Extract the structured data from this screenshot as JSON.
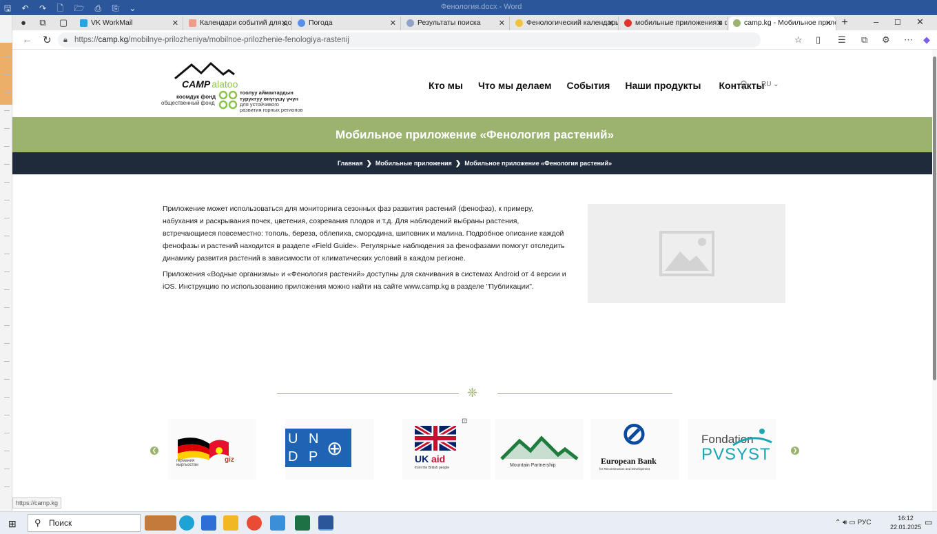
{
  "word": {
    "title": "Фенология.docx - Word",
    "quick_access": "🖫 ↶ ↷ 🗋 🗁 ⎙ ⎘ ⌄"
  },
  "browser": {
    "tabs": [
      {
        "label": "VK WorkMail",
        "color": "#2aa2e0"
      },
      {
        "label": "Календари событий для дош",
        "color": "#f19b8a"
      },
      {
        "label": "Погода",
        "color": "#5a8fe8"
      },
      {
        "label": "Результаты поиска",
        "color": "#8fa3c8"
      },
      {
        "label": "Фенологический календарь",
        "color": "#f2c23a"
      },
      {
        "label": "мобильные приложения в ф",
        "color": "#e2322c"
      },
      {
        "label": "camp.kg - Мобильное прило",
        "color": "#9bb36f"
      }
    ],
    "close_glyph": "✕",
    "new_tab_glyph": "+",
    "url_prefix": "https://",
    "url_domain": "camp.kg",
    "url_path": "/mobilnye-prilozheniya/mobilnoe-prilozhenie-fenologiya-rastenij",
    "status_url": "https://camp.kg"
  },
  "site": {
    "logo": {
      "brand": "CAMP",
      "brand_tail": "alatoo",
      "left_line1": "коомдук фонд",
      "left_line2": "общественный фонд",
      "right_line1": "тоолуу аймактардын",
      "right_line2": "туруктуу өнүгүшү үчүн",
      "right_line3": "для устойчивого",
      "right_line4": "развития горных регионов"
    },
    "nav": [
      "Кто мы",
      "Что мы делаем",
      "События",
      "Наши продукты",
      "Контакты"
    ],
    "lang": "RU",
    "page_title": "Мобильное приложение «Фенология растений»",
    "breadcrumbs": [
      "Главная",
      "Мобильные приложения",
      "Мобильное приложение «Фенология растений»"
    ],
    "paragraph1": "Приложение может использоваться для мониторинга сезонных фаз развития растений (фенофаз), к примеру, набухания и раскрывания почек, цветения, созревания плодов и т.д. Для наблюдений выбраны растения, встречающиеся повсеместно: тополь, береза, облепиха, смородина, шиповник и малина. Подробное описание каждой фенофазы и растений находится в разделе «Field Guide». Регулярные наблюдения за фенофазами помогут отследить динамику развития растений в зависимости от климатических условий в каждом регионе.",
    "paragraph2": "Приложения «Водные организмы» и «Фенология растений» доступны для скачивания в системах Android от 4 версии и iOS. Инструкцию по использованию приложения можно найти на сайте www.camp.kg в разделе \"Публикации\".",
    "partners": [
      {
        "line1": "германия",
        "line2": "кыргызстан",
        "mark": "giz"
      },
      {
        "line1": "U N",
        "line2": "D P"
      },
      {
        "line1": "UK",
        "line2": "aid",
        "line3": "from the British people"
      },
      {
        "line1": "Mountain Partnership"
      },
      {
        "line1": "European Bank",
        "line2": "for Reconstruction and Development"
      },
      {
        "line1": "Fondation",
        "line2": "PVSYST"
      }
    ]
  },
  "taskbar": {
    "search_placeholder": "Поиск",
    "lang": "РУС",
    "time": "16:12",
    "date": "22.01.2025"
  }
}
